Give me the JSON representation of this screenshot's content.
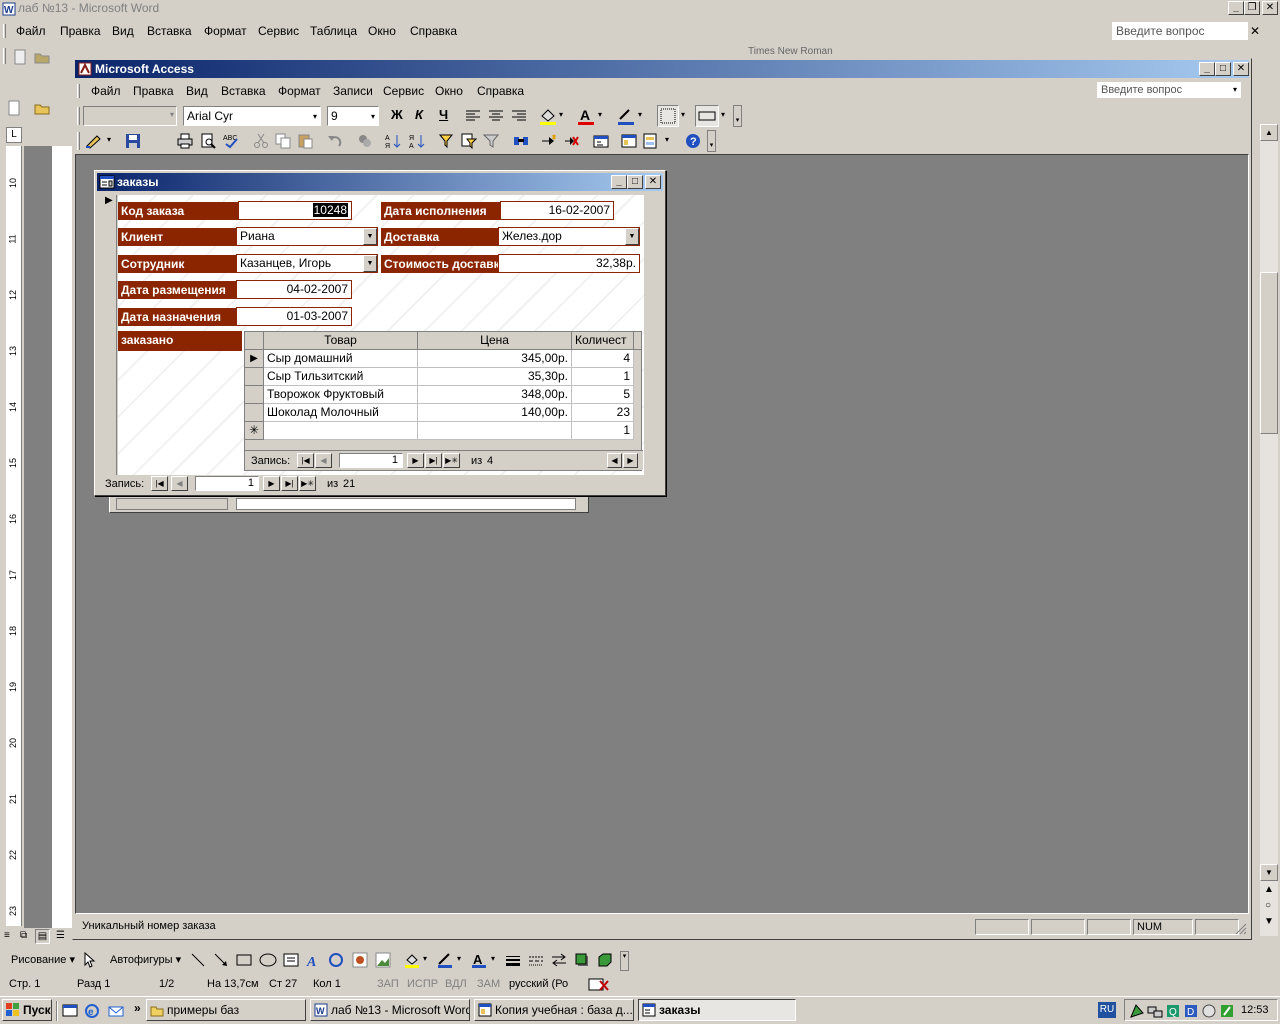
{
  "word": {
    "title": "лаб №13 - Microsoft Word",
    "menu": [
      "Файл",
      "Правка",
      "Вид",
      "Вставка",
      "Формат",
      "Сервис",
      "Таблица",
      "Окно",
      "Справка"
    ],
    "ask_placeholder": "Введите вопрос",
    "font_hint": "Times New Roman",
    "ruler_numbers": [
      "10",
      "11",
      "12",
      "13",
      "14",
      "15",
      "16",
      "17",
      "18",
      "19",
      "20",
      "21",
      "22",
      "23"
    ],
    "drawing": {
      "draw_label": "Рисование",
      "autoshapes_label": "Автофигуры"
    },
    "status": {
      "page": "Стр. 1",
      "section": "Разд 1",
      "pages": "1/2",
      "at": "На 13,7см",
      "line": "Ст 27",
      "col": "Кол 1",
      "rec": "ЗАП",
      "trk": "ИСПР",
      "ext": "ВДЛ",
      "ovr": "ЗАМ",
      "lang": "русский (Ро"
    }
  },
  "access": {
    "title": "Microsoft Access",
    "menu": [
      "Файл",
      "Правка",
      "Вид",
      "Вставка",
      "Формат",
      "Записи",
      "Сервис",
      "Окно",
      "Справка"
    ],
    "ask_placeholder": "Введите вопрос",
    "font_name": "Arial Cyr",
    "font_size": "9",
    "status_text": "Уникальный номер заказа",
    "status_num": "NUM"
  },
  "form": {
    "title": "заказы",
    "fields": {
      "order_code_label": "Код заказа",
      "order_code": "10248",
      "done_date_label": "Дата исполнения",
      "done_date": "16-02-2007",
      "client_label": "Клиент",
      "client": "Риана",
      "delivery_label": "Доставка",
      "delivery": "Желез.дор",
      "employee_label": "Сотрудник",
      "employee": "Казанцев, Игорь",
      "delivery_cost_label": "Стоимость доставки",
      "delivery_cost": "32,38р.",
      "placed_date_label": "Дата размещения",
      "placed_date": "04-02-2007",
      "assigned_date_label": "Дата назначения",
      "assigned_date": "01-03-2007",
      "ordered_label": "заказано"
    },
    "subform": {
      "columns": [
        "Товар",
        "Цена",
        "Количест"
      ],
      "rows": [
        [
          "Сыр домашний",
          "345,00р.",
          "4"
        ],
        [
          "Сыр Тильзитский",
          "35,30р.",
          "1"
        ],
        [
          "Творожок Фруктовый",
          "348,00р.",
          "5"
        ],
        [
          "Шоколад Молочный",
          "140,00р.",
          "23"
        ],
        [
          "",
          "",
          "1"
        ]
      ],
      "nav_label": "Запись:",
      "nav_current": "1",
      "nav_of": "из",
      "nav_total": "4"
    },
    "nav": {
      "label": "Запись:",
      "current": "1",
      "of": "из",
      "total": "21"
    }
  },
  "taskbar": {
    "start": "Пуск",
    "tasks": [
      "примеры баз",
      "лаб №13 - Microsoft Word",
      "Копия учебная : база д...",
      "заказы"
    ],
    "lang": "RU",
    "clock": "12:53"
  }
}
